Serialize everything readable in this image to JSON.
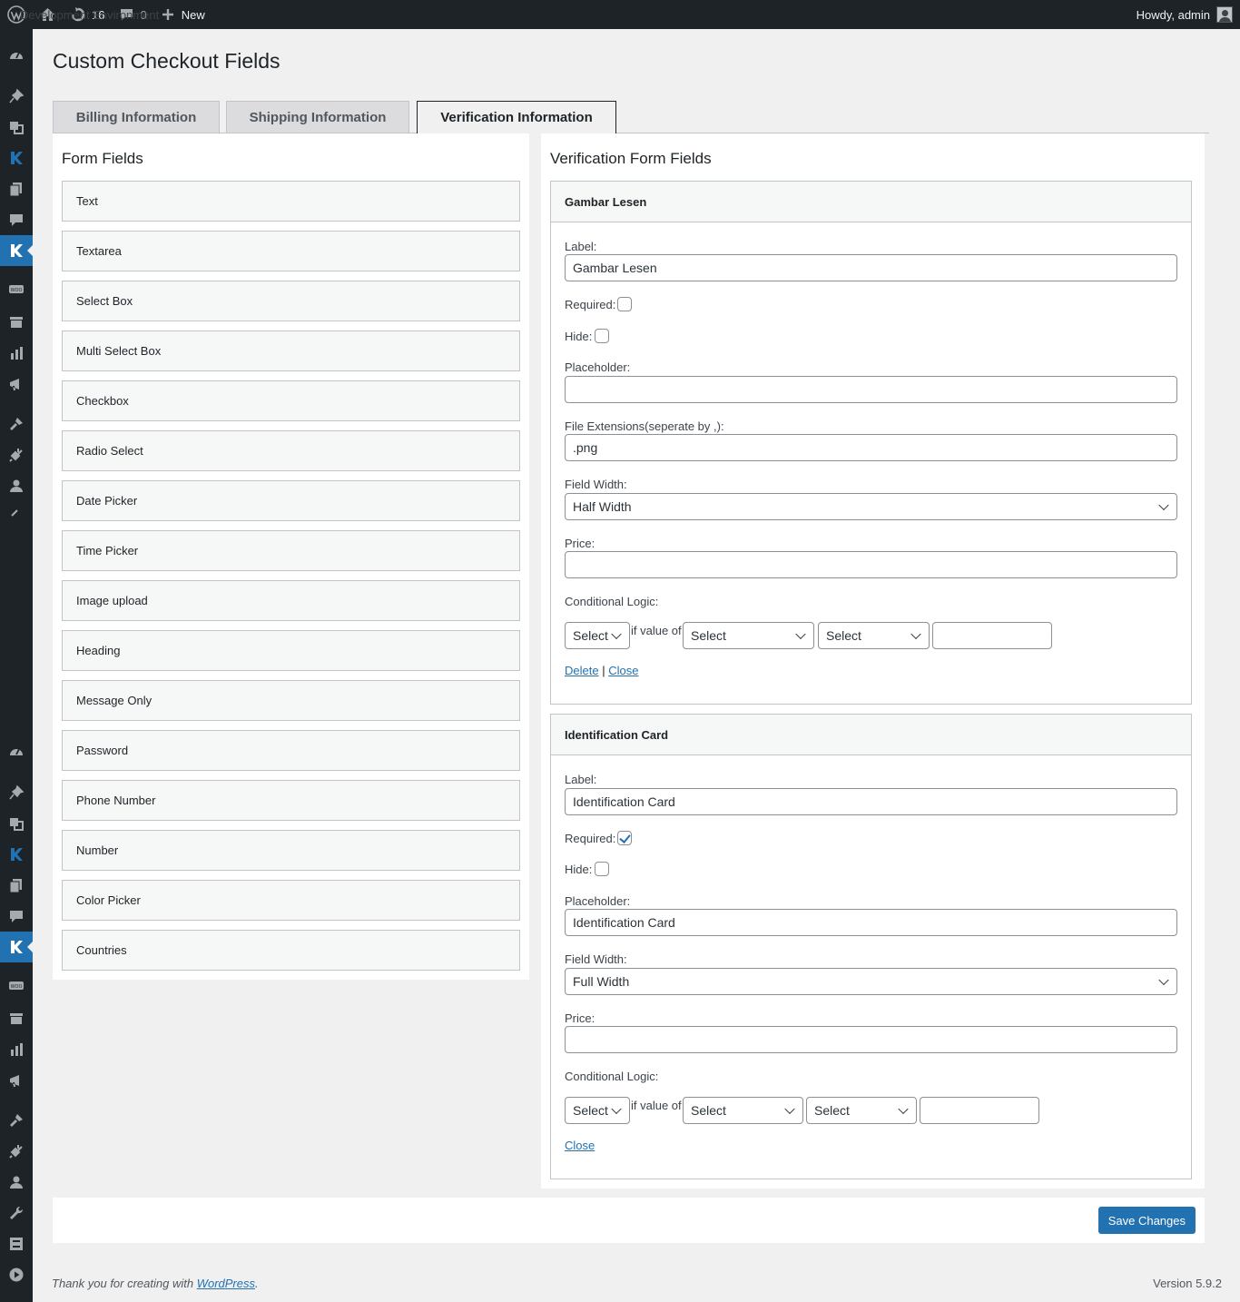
{
  "adminbar": {
    "site_name": "Development Environment",
    "updates_count": "16",
    "comments_count": "0",
    "new_label": "New",
    "howdy": "Howdy, admin"
  },
  "page": {
    "title": "Custom Checkout Fields"
  },
  "tabs": [
    {
      "label": "Billing Information",
      "active": false
    },
    {
      "label": "Shipping Information",
      "active": false
    },
    {
      "label": "Verification Information",
      "active": true
    }
  ],
  "form_fields": {
    "heading": "Form Fields",
    "items": [
      "Text",
      "Textarea",
      "Select Box",
      "Multi Select Box",
      "Checkbox",
      "Radio Select",
      "Date Picker",
      "Time Picker",
      "Image upload",
      "Heading",
      "Message Only",
      "Password",
      "Phone Number",
      "Number",
      "Color Picker",
      "Countries"
    ]
  },
  "verification": {
    "heading": "Verification Form Fields",
    "labels": {
      "label": "Label:",
      "required": "Required:",
      "hide": "Hide:",
      "placeholder": "Placeholder:",
      "file_ext": "File Extensions(seperate by ,):",
      "field_width": "Field Width:",
      "price": "Price:",
      "conditional": "Conditional Logic:",
      "if_value_of": "if value of",
      "select": "Select",
      "delete": "Delete",
      "close": "Close",
      "separator": "|"
    },
    "cards": [
      {
        "title": "Gambar Lesen",
        "label_value": "Gambar Lesen",
        "required": false,
        "hide": false,
        "placeholder_value": "",
        "file_extensions": ".png",
        "field_width": "Half Width",
        "price": ""
      },
      {
        "title": "Identification Card",
        "label_value": "Identification Card",
        "required": true,
        "hide": false,
        "placeholder_value": "Identification Card",
        "field_width": "Full Width",
        "price": ""
      }
    ]
  },
  "save_button": "Save Changes",
  "footer": {
    "thanks_prefix": "Thank you for creating with ",
    "wordpress_link": "WordPress",
    "thanks_suffix": ".",
    "version": "Version 5.9.2"
  },
  "colors": {
    "accent": "#2271b1",
    "adminbar_bg": "#1d2327"
  }
}
